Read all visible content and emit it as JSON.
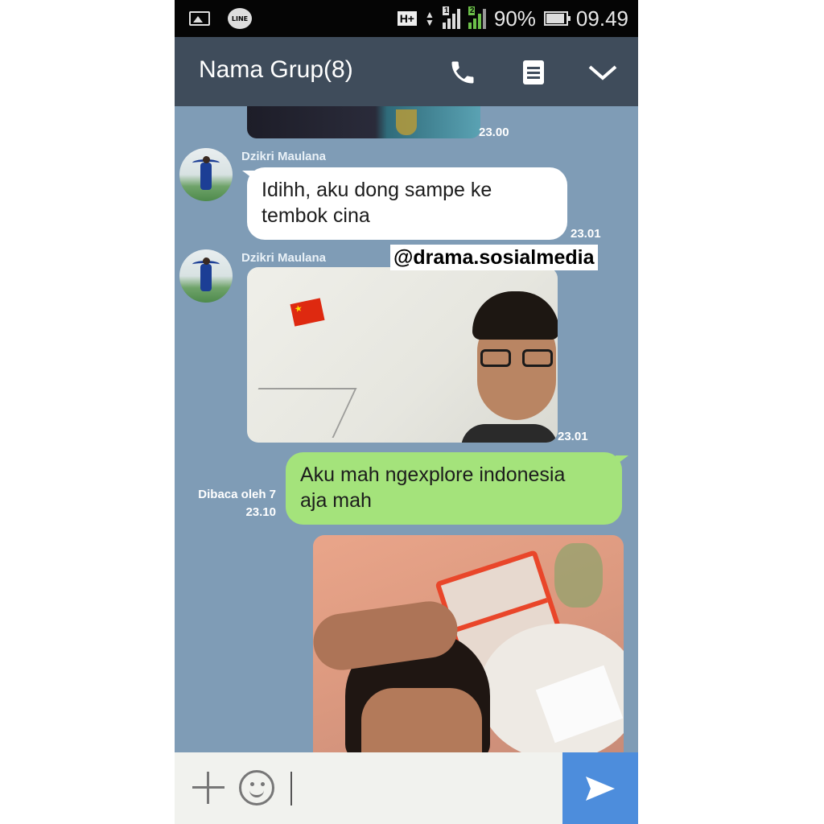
{
  "status_bar": {
    "network_type": "H+",
    "sim1": "1",
    "sim2": "2",
    "battery": "90%",
    "battery_level": 0.9,
    "time": "09.49",
    "icons": [
      "image-icon",
      "line-icon",
      "signal-icon",
      "battery-icon"
    ]
  },
  "header": {
    "title": "Nama Grup(8)",
    "icons": [
      "phone-icon",
      "notes-icon",
      "chevron-down-icon"
    ]
  },
  "messages": [
    {
      "type": "photo",
      "direction": "incoming",
      "time": "23.00"
    },
    {
      "type": "text",
      "direction": "incoming",
      "sender": "Dzikri Maulana",
      "text_line1": "Idihh, aku dong sampe ke",
      "text_line2": "tembok cina",
      "time": "23.01"
    },
    {
      "type": "photo",
      "direction": "incoming",
      "sender": "Dzikri Maulana",
      "time": "23.01"
    },
    {
      "type": "text",
      "direction": "outgoing",
      "text_line1": "Aku mah ngexplore indonesia",
      "text_line2": "aja mah",
      "read_receipt": "Dibaca oleh 7",
      "time": "23.10"
    },
    {
      "type": "photo",
      "direction": "outgoing"
    }
  ],
  "watermark": "@drama.sosialmedia",
  "input_bar": {
    "icons": [
      "plus-icon",
      "emoji-icon",
      "send-icon"
    ],
    "value": ""
  },
  "colors": {
    "header_bg": "#3f4c5b",
    "chat_bg": "#7f9cb6",
    "outgoing_bubble": "#a4e37b",
    "incoming_bubble": "#ffffff",
    "send_button": "#4d8ddc"
  }
}
